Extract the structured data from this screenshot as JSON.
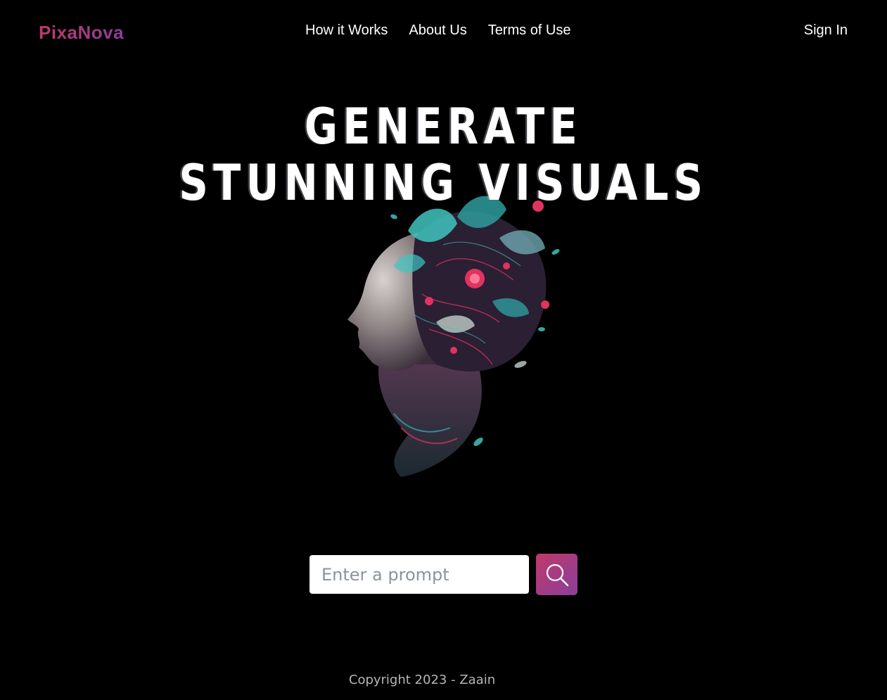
{
  "brand": {
    "name": "PixaNova",
    "gradient_start": "#c0396b",
    "gradient_end": "#8a3f9a"
  },
  "nav": {
    "items": [
      {
        "label": "How it Works"
      },
      {
        "label": "About Us"
      },
      {
        "label": "Terms of Use"
      }
    ],
    "sign_in_label": "Sign In"
  },
  "hero": {
    "title_line_1": "GENERATE",
    "title_line_2": "STUNNING VISUALS",
    "image_description_icon": "floral-head-illustration"
  },
  "prompt": {
    "placeholder": "Enter a prompt",
    "value": "",
    "submit_icon": "search-icon"
  },
  "footer": {
    "copyright": "Copyright 2023 - Zaain"
  },
  "colors": {
    "background": "#000000",
    "text": "#ffffff",
    "footer_text": "#b5b5b5",
    "accent_teal": "#3fc4c0",
    "accent_pink": "#e0335f"
  }
}
